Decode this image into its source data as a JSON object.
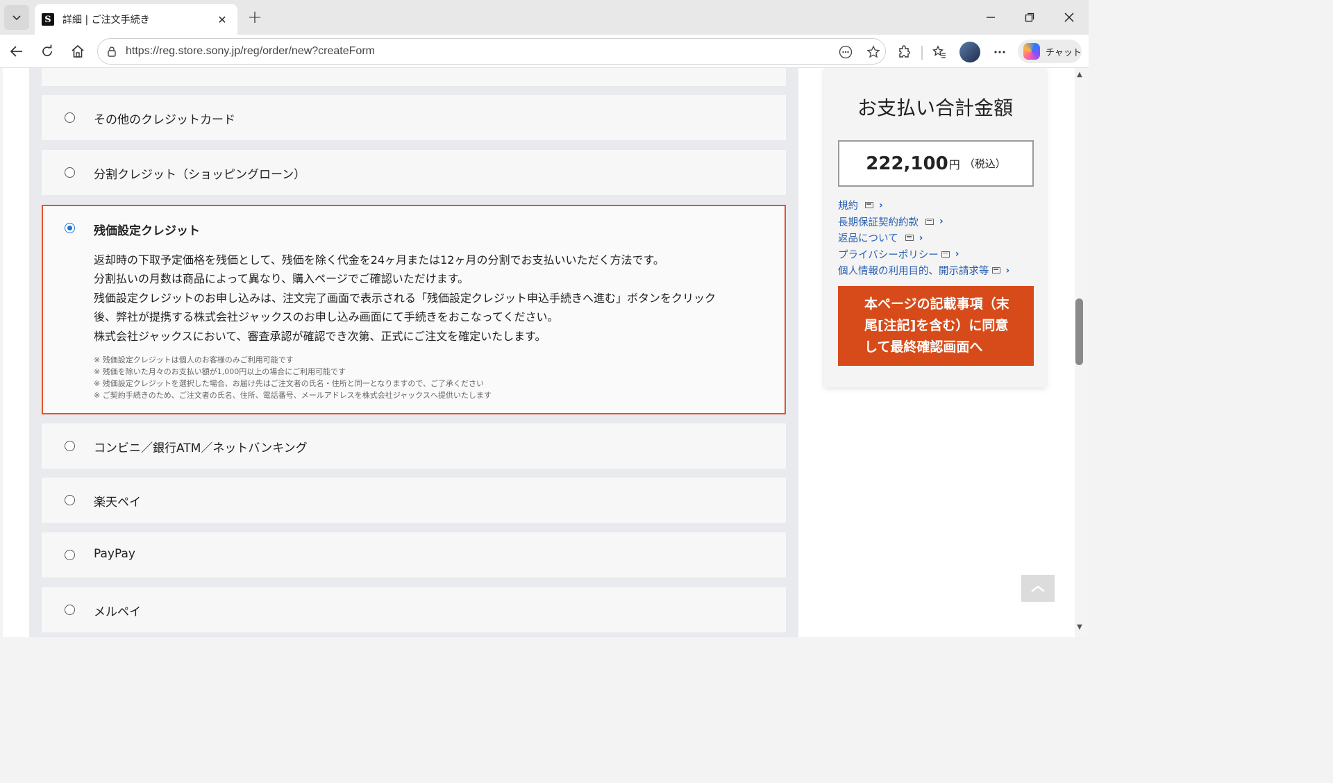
{
  "browser": {
    "tab_title": "詳細 | ご注文手続き",
    "favicon_letter": "S",
    "url": "https://reg.store.sony.jp/reg/order/new?createForm",
    "chat_label": "チャット"
  },
  "payment": {
    "options": {
      "other_card": "その他のクレジットカード",
      "installment": "分割クレジット（ショッピングローン）",
      "convenience": "コンビニ／銀行ATM／ネットバンキング",
      "rakuten": "楽天ペイ",
      "paypay": "PayPay",
      "merpay": "メルペイ"
    },
    "selected": {
      "title": "残価設定クレジット",
      "desc": [
        "返却時の下取予定価格を残価として、残価を除く代金を24ヶ月または12ヶ月の分割でお支払いいただく方法です。",
        "分割払いの月数は商品によって異なり、購入ページでご確認いただけます。",
        "残価設定クレジットのお申し込みは、注文完了画面で表示される「残価設定クレジット申込手続きへ進む」ボタンをクリック",
        "後、弊社が提携する株式会社ジャックスのお申し込み画面にて手続きをおこなってください。",
        "株式会社ジャックスにおいて、審査承認が確認でき次第、正式にご注文を確定いたします。"
      ],
      "notes": [
        "※ 残価設定クレジットは個人のお客様のみご利用可能です",
        "※ 残価を除いた月々のお支払い額が1,000円以上の場合にご利用可能です",
        "※ 残価設定クレジットを選択した場合、お届け先はご注文者の氏名・住所と同一となりますので、ご了承ください",
        "※ ご契約手続きのため、ご注文者の氏名、住所、電話番号、メールアドレスを株式会社ジャックスへ提供いたします"
      ]
    }
  },
  "summary": {
    "title": "お支払い合計金額",
    "amount": "222,100",
    "currency": "円",
    "tax_note": "（税込）",
    "links": [
      "規約",
      "長期保証契約約款",
      "返品について",
      "プライバシーポリシー",
      "個人情報の利用目的、開示請求等"
    ],
    "cta_label": "本ページの記載事項（末尾[注記]を含む）に同意して最終確認画面へ"
  },
  "colors": {
    "accent_orange": "#d74b1a",
    "selected_border": "#e3522b",
    "radio_selected": "#1a73d8",
    "link_blue": "#2a5fb0"
  }
}
